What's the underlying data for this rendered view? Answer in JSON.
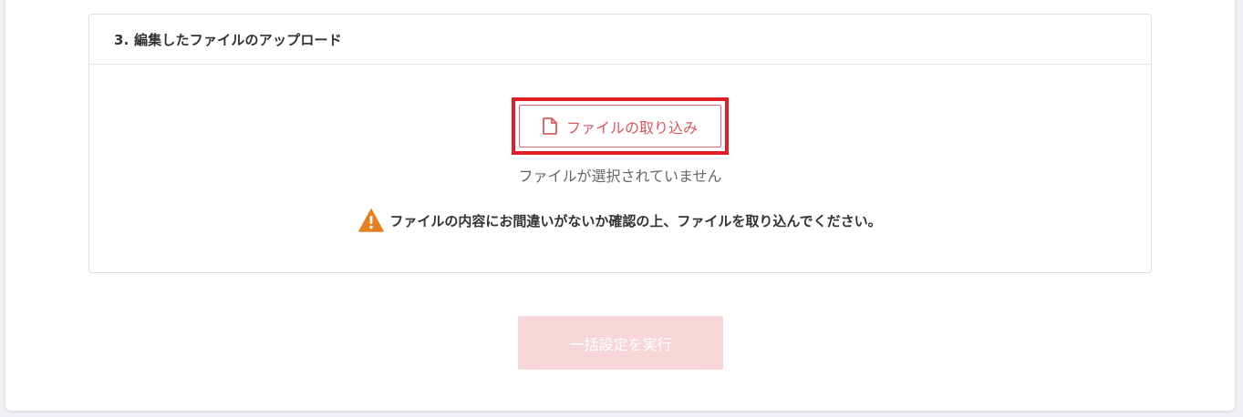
{
  "section": {
    "title": "3. 編集したファイルのアップロード"
  },
  "import_button": {
    "label": "ファイルの取り込み",
    "icon": "file-icon",
    "color": "#d9595f"
  },
  "file_status": "ファイルが選択されていません",
  "warning": {
    "icon": "warning-triangle-icon",
    "text": "ファイルの内容にお間違いがないか確認の上、ファイルを取り込んでください。",
    "color": "#e67e22"
  },
  "execute_button": {
    "label": "一括設定を実行",
    "state": "disabled",
    "color": "#f6d6d9"
  },
  "highlight_color": "#e01e25"
}
